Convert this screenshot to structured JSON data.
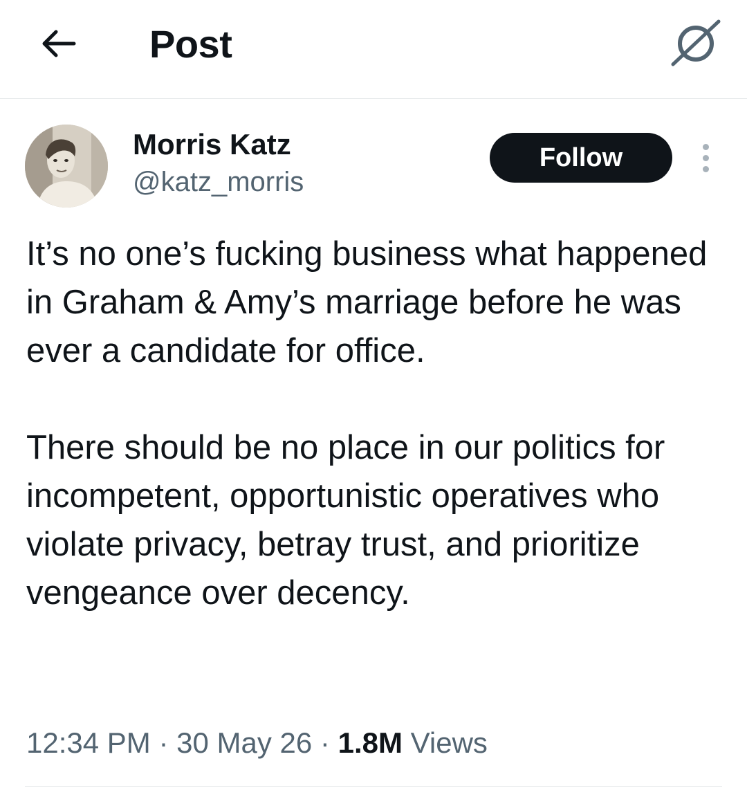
{
  "header": {
    "title": "Post",
    "back_icon": "arrow-left-icon",
    "grok_icon": "grok-icon"
  },
  "author": {
    "name": "Morris Katz",
    "handle": "@katz_morris",
    "follow_label": "Follow",
    "more_icon": "more-vertical-icon"
  },
  "tweet": {
    "paragraph_1": "It’s no one’s fucking business what happened in Graham & Amy’s marriage before he was ever a candidate for office.",
    "paragraph_2": "There should be no place in our politics for incompetent, opportunistic operatives who violate privacy, betray trust, and prioritize vengeance over decency."
  },
  "meta": {
    "time": "12:34 PM",
    "separator": "·",
    "date": "30 May 26",
    "views_count": "1.8M",
    "views_label": "Views"
  },
  "colors": {
    "text": "#0f1419",
    "secondary": "#536471",
    "follow_bg": "#0f1419",
    "divider": "#e6e9ea"
  }
}
